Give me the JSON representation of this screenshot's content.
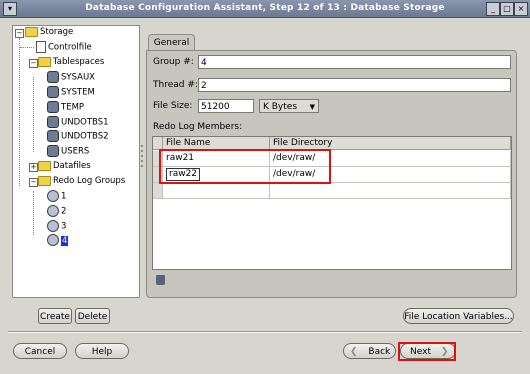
{
  "window": {
    "title": "Database Configuration Assistant, Step 12 of 13 : Database Storage",
    "menu_glyph": "▾",
    "min_glyph": "_",
    "max_glyph": "□",
    "close_glyph": "×"
  },
  "tree": {
    "root": "Storage",
    "controlfile": "Controlfile",
    "tablespaces": "Tablespaces",
    "tablespace_items": [
      "SYSAUX",
      "SYSTEM",
      "TEMP",
      "UNDOTBS1",
      "UNDOTBS2",
      "USERS"
    ],
    "datafiles": "Datafiles",
    "redo_log_groups": "Redo Log Groups",
    "group_items": [
      "1",
      "2",
      "3",
      "4"
    ],
    "selected_group": "4"
  },
  "tab": {
    "general": "General"
  },
  "form": {
    "group_label": "Group #:",
    "group_value": "4",
    "thread_label": "Thread #:",
    "thread_value": "2",
    "file_size_label": "File Size:",
    "file_size_value": "51200",
    "size_unit": "K Bytes",
    "redo_members_label": "Redo Log Members:"
  },
  "table": {
    "columns": [
      "File Name",
      "File Directory"
    ],
    "rows": [
      {
        "file_name": "raw21",
        "file_directory": "/dev/raw/"
      },
      {
        "file_name": "raw22",
        "file_directory": "/dev/raw/"
      }
    ]
  },
  "buttons": {
    "create": "Create",
    "delete": "Delete",
    "file_location_variables": "File Location Variables...",
    "cancel": "Cancel",
    "help": "Help",
    "back": "Back",
    "next": "Next",
    "back_arrow": "❮",
    "next_arrow": "❯"
  },
  "colors": {
    "title_bar": "#6b7891",
    "selection": "#1b2ee0",
    "highlight": "#e01010"
  }
}
